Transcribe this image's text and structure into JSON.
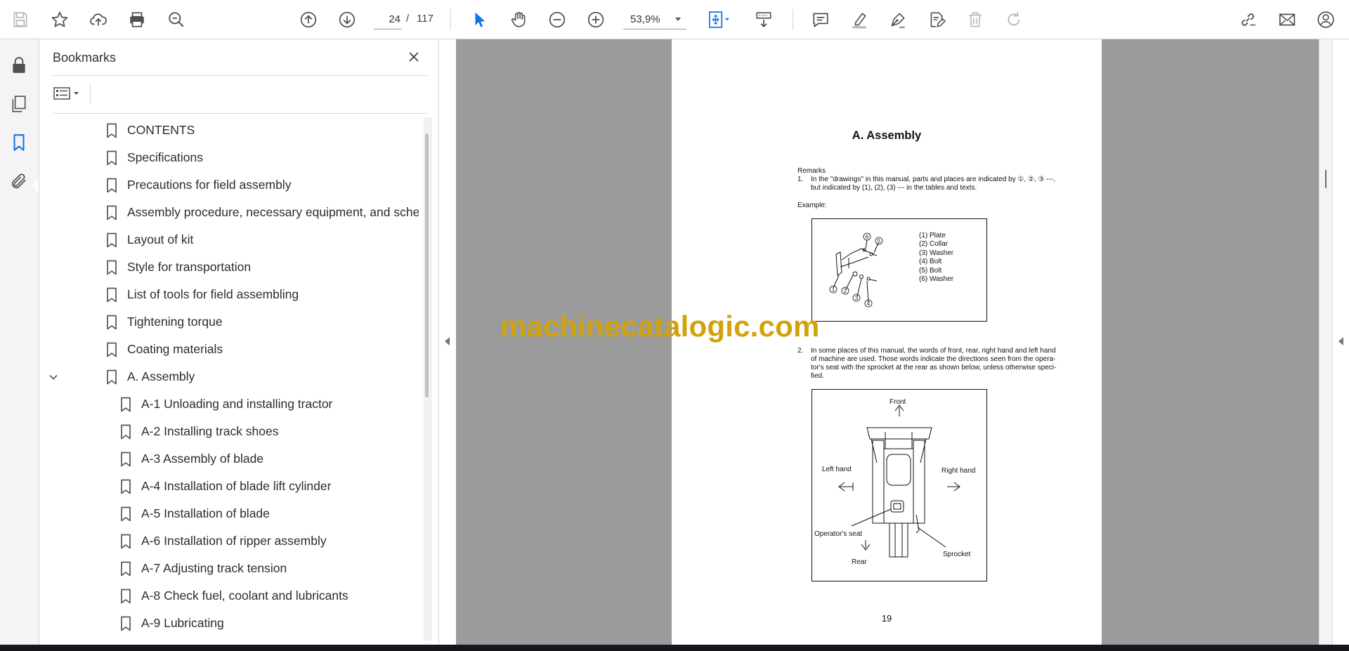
{
  "toolbar": {
    "current_page": "24",
    "page_separator": "/",
    "total_pages": "117",
    "zoom": "53,9%"
  },
  "bookmarks": {
    "title": "Bookmarks",
    "items": [
      {
        "label": "CONTENTS",
        "level": 0
      },
      {
        "label": "Specifications",
        "level": 0
      },
      {
        "label": "Precautions for field assembly",
        "level": 0
      },
      {
        "label": "Assembly procedure, necessary equipment, and schedule",
        "level": 0
      },
      {
        "label": "Layout of kit",
        "level": 0
      },
      {
        "label": "Style for transportation",
        "level": 0
      },
      {
        "label": "List of tools for field assembling",
        "level": 0
      },
      {
        "label": "Tightening torque",
        "level": 0
      },
      {
        "label": "Coating materials",
        "level": 0
      },
      {
        "label": "A. Assembly",
        "level": 0,
        "expanded": true
      },
      {
        "label": "A-1 Unloading and installing tractor",
        "level": 1
      },
      {
        "label": "A-2 Installing track shoes",
        "level": 1
      },
      {
        "label": "A-3 Assembly of blade",
        "level": 1
      },
      {
        "label": "A-4 Installation of blade lift cylinder",
        "level": 1
      },
      {
        "label": "A-5 Installation of blade",
        "level": 1
      },
      {
        "label": "A-6 Installation of ripper assembly",
        "level": 1
      },
      {
        "label": "A-7 Adjusting track tension",
        "level": 1
      },
      {
        "label": "A-8 Check fuel, coolant and lubricants",
        "level": 1
      },
      {
        "label": "A-9 Lubricating",
        "level": 1
      }
    ]
  },
  "document": {
    "heading": "A.  Assembly",
    "remarks_label": "Remarks",
    "remark1_num": "1.",
    "remark1_line1": "In the \"drawings\" in this manual, parts and places are indicated by ①, ②, ③ ---,",
    "remark1_line2": "but indicated by (1), (2), (3) --- in the tables and texts.",
    "example_label": "Example:",
    "parts": [
      "(1) Plate",
      "(2) Collar",
      "(3) Washer",
      "(4) Bolt",
      "(5) Bolt",
      "(6) Washer"
    ],
    "callouts": [
      "1",
      "2",
      "3",
      "4",
      "5",
      "6"
    ],
    "remark2_num": "2.",
    "remark2_lines": [
      "In some places of this manual, the words of front, rear, right hand and left hand",
      "of machine are used.  Those words indicate the directions seen from the opera-",
      "tor's seat with the sprocket at the rear as shown below, unless otherwise speci-",
      "fied."
    ],
    "fig2": {
      "front": "Front",
      "left_hand": "Left hand",
      "right_hand": "Right hand",
      "operators_seat": "Operator's seat",
      "sprocket": "Sprocket",
      "rear": "Rear"
    },
    "page_number": "19"
  },
  "watermark": "machinecatalogic.com",
  "colors": {
    "accent_blue": "#1473e6",
    "icon_gray": "#505050",
    "disabled_gray": "#b9b9b9",
    "doc_background": "#9b9b9b",
    "watermark": "#d1a20a"
  }
}
